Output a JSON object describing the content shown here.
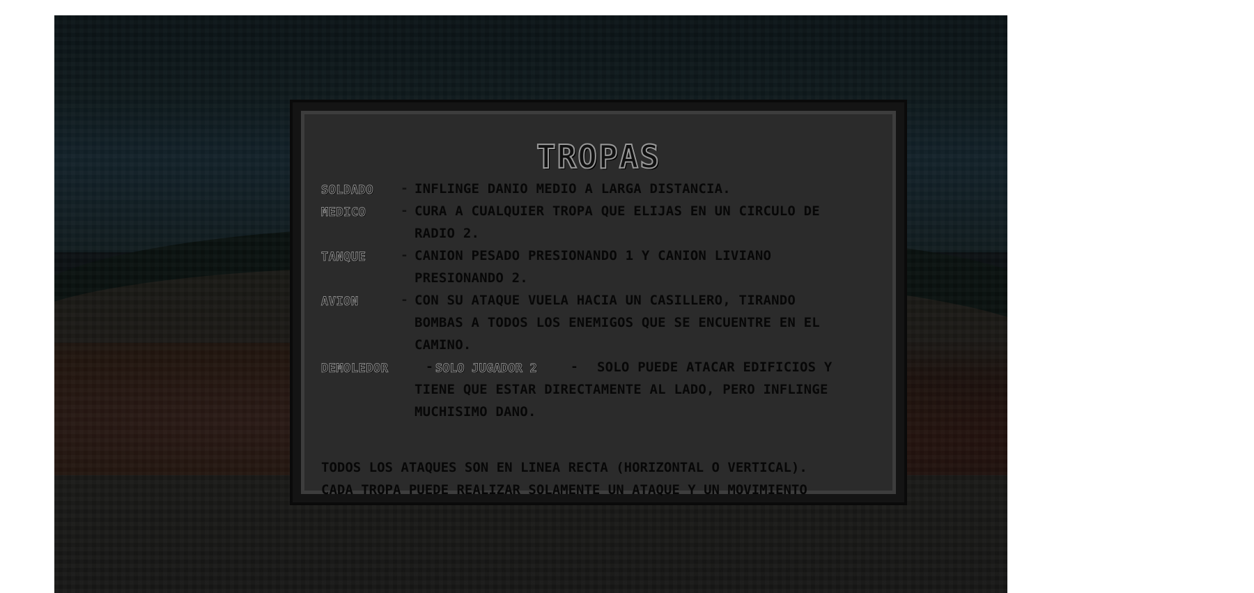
{
  "panel": {
    "title": "TROPAS"
  },
  "troops": [
    {
      "name": "SOLDADO",
      "separator": "-",
      "lines": [
        "INFLINGE DANIO MEDIO A LARGA DISTANCIA."
      ]
    },
    {
      "name": "MEDICO",
      "separator": "-",
      "lines": [
        "CURA A CUALQUIER TROPA QUE ELIJAS EN UN CIRCULO DE",
        "RADIO 2."
      ]
    },
    {
      "name": "TANQUE",
      "separator": "-",
      "lines": [
        "CANION PESADO PRESIONANDO 1 Y CANION LIVIANO",
        "PRESIONANDO 2."
      ]
    },
    {
      "name": "AVION",
      "separator": "-",
      "lines": [
        "CON SU ATAQUE VUELA HACIA UN CASILLERO, TIRANDO",
        "BOMBAS A TODOS LOS ENEMIGOS QUE SE ENCUENTRE EN EL",
        "CAMINO."
      ]
    }
  ],
  "demoledor": {
    "name": "DEMOLEDOR",
    "separator1": "-",
    "tag": "SOLO JUGADOR 2",
    "separator2": "-",
    "first_line": "SOLO PUEDE ATACAR EDIFICIOS Y",
    "rest_lines": [
      "TIENE QUE ESTAR DIRECTAMENTE AL LADO, PERO INFLINGE",
      "MUCHISIMO DANO."
    ]
  },
  "footer": {
    "line1": "TODOS LOS ATAQUES SON EN LINEA RECTA (HORIZONTAL O VERTICAL).",
    "line2": "CADA TROPA PUEDE REALIZAR SOLAMENTE UN ATAQUE Y UN MOVIMIENTO"
  }
}
